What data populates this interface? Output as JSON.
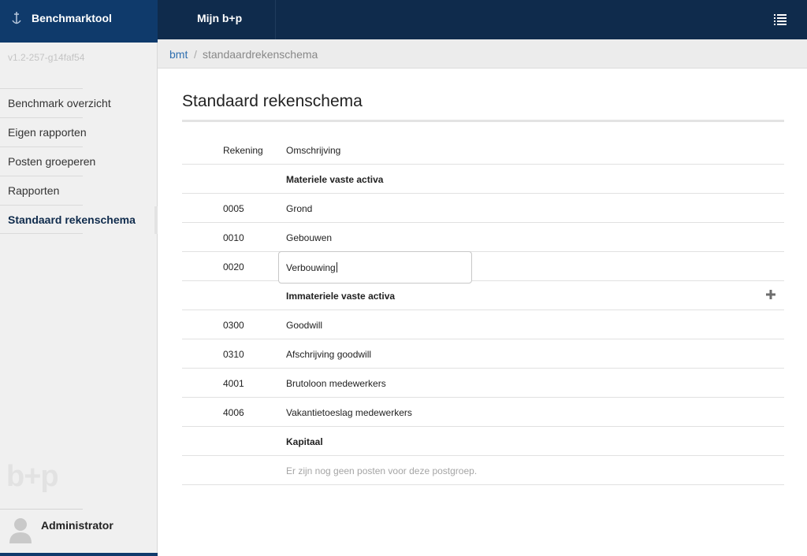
{
  "app": {
    "brand": "Benchmarktool",
    "section": "Mijn b+p",
    "version": "v1.2-257-g14faf54",
    "logo_text": "b+p",
    "icons": {
      "brand": "anchor-icon",
      "menu": "list-menu-icon",
      "user": "user-avatar-icon",
      "add": "plus-icon"
    },
    "colors": {
      "topbar": "#0f2b4c",
      "brand": "#0f3a6b",
      "link": "#2f6fb0"
    }
  },
  "sidebar": {
    "items": [
      {
        "label": "Benchmark overzicht"
      },
      {
        "label": "Eigen rapporten"
      },
      {
        "label": "Posten groeperen"
      },
      {
        "label": "Rapporten"
      },
      {
        "label": "Standaard rekenschema"
      }
    ],
    "active": "Standaard rekenschema",
    "user": "Administrator"
  },
  "breadcrumb": {
    "root": "bmt",
    "separator": "/",
    "current": "standaardrekenschema"
  },
  "main": {
    "title": "Standaard rekenschema",
    "columns": {
      "account": "Rekening",
      "description": "Omschrijving"
    },
    "groups": [
      {
        "name": "Materiele vaste activa",
        "rows": [
          {
            "account": "0005",
            "description": "Grond"
          },
          {
            "account": "0010",
            "description": "Gebouwen"
          },
          {
            "account": "0020",
            "description": "Verbouwing"
          }
        ]
      },
      {
        "name": "Immateriele vaste activa",
        "rows": [
          {
            "account": "0300",
            "description": "Goodwill"
          },
          {
            "account": "0310",
            "description": "Afschrijving goodwill"
          },
          {
            "account": "4001",
            "description": "Brutoloon medewerkers"
          },
          {
            "account": "4006",
            "description": "Vakantietoeslag medewerkers"
          }
        ]
      },
      {
        "name": "Kapitaal",
        "empty_text": "Er zijn nog geen posten voor deze postgroep."
      }
    ]
  }
}
